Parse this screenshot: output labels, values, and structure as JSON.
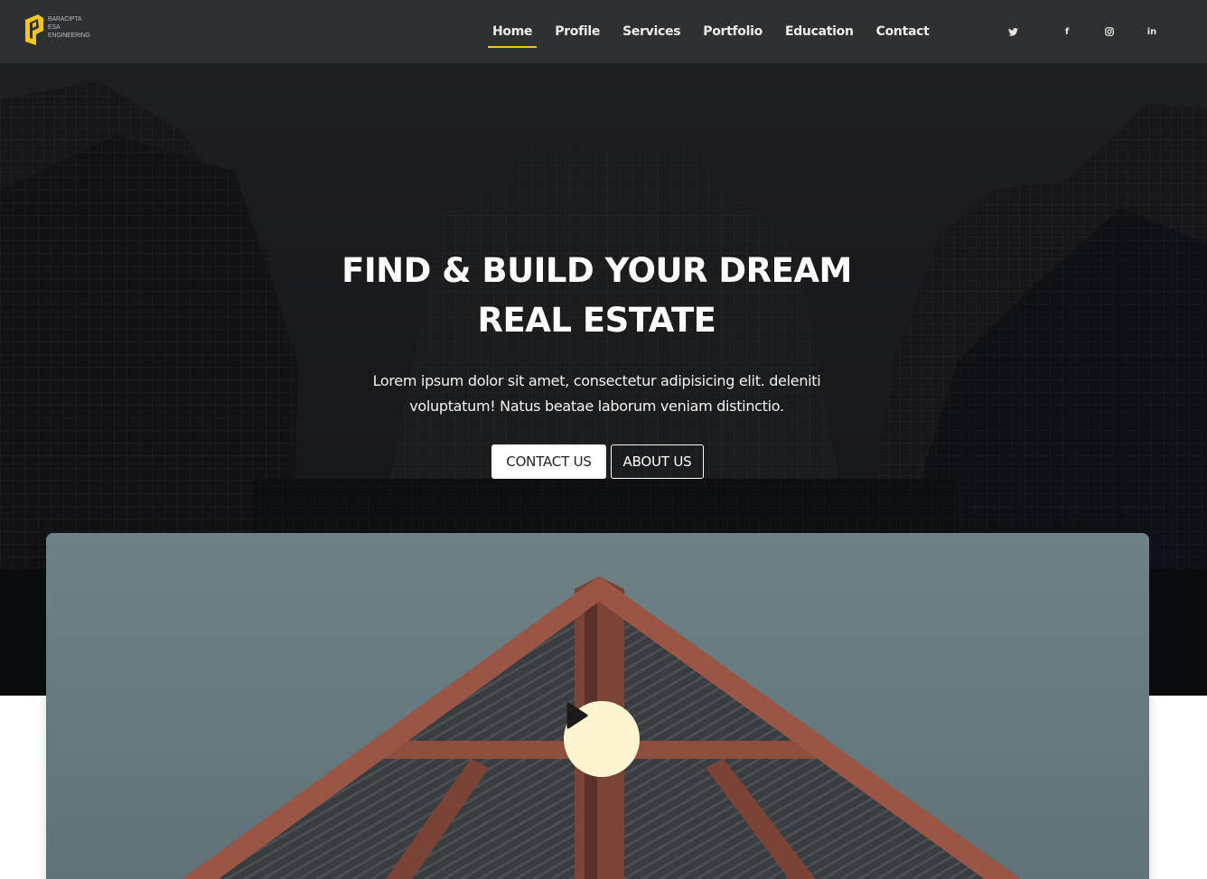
{
  "logo": {
    "lines": [
      "BARACIPTA",
      "ESA",
      "ENGINEERING"
    ],
    "accent": "#f5c518"
  },
  "nav": {
    "items": [
      {
        "label": "Home",
        "active": true
      },
      {
        "label": "Profile"
      },
      {
        "label": "Services"
      },
      {
        "label": "Portfolio"
      },
      {
        "label": "Education"
      },
      {
        "label": "Contact"
      }
    ]
  },
  "social": {
    "twitter": "twitter-icon",
    "facebook": "f",
    "instagram": "instagram-icon",
    "linkedin": "in"
  },
  "hero": {
    "title_line1": "FIND & BUILD YOUR DREAM",
    "title_line2": "REAL ESTATE",
    "subtitle_line1": "Lorem ipsum dolor sit amet, consectetur adipisicing elit. deleniti",
    "subtitle_line2": "voluptatum! Natus beatae laborum veniam distinctio.",
    "contact_label": "CONTACT US",
    "about_label": "ABOUT US"
  },
  "video": {
    "play_icon": "play-icon"
  },
  "colors": {
    "header_bg": "#2f3031",
    "accent": "#f5c518",
    "play_bg": "#fdf5d0"
  }
}
